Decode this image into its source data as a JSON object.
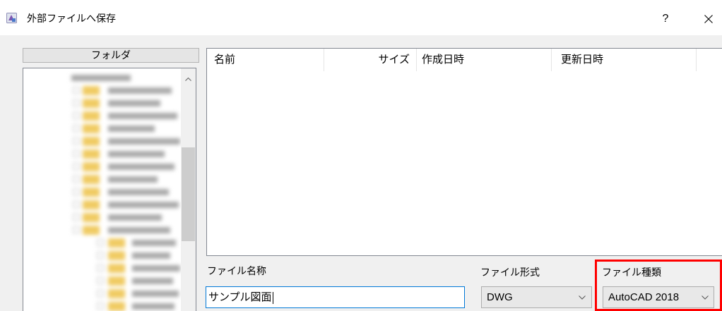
{
  "window": {
    "title": "外部ファイルへ保存",
    "help_label": "?",
    "app_icon": "app-icon",
    "close_icon": "close-icon"
  },
  "folder_panel": {
    "header": "フォルダ",
    "scroll_up_icon": "chevron-up-icon",
    "folder_icon": "folder-icon"
  },
  "file_list": {
    "columns": [
      "名前",
      "サイズ",
      "作成日時",
      "更新日時"
    ],
    "rows": []
  },
  "save_options": {
    "file_name": {
      "label": "ファイル名称",
      "value": "サンプル図面"
    },
    "file_format": {
      "label": "ファイル形式",
      "selected": "DWG",
      "dropdown_icon": "chevron-down-icon"
    },
    "file_type": {
      "label": "ファイル種類",
      "selected": "AutoCAD 2018",
      "dropdown_icon": "chevron-down-icon"
    }
  },
  "colors": {
    "accent": "#0078d7",
    "highlight": "#ff0000",
    "window_background": "#f0f0f0",
    "folder": "#f0cb63"
  }
}
